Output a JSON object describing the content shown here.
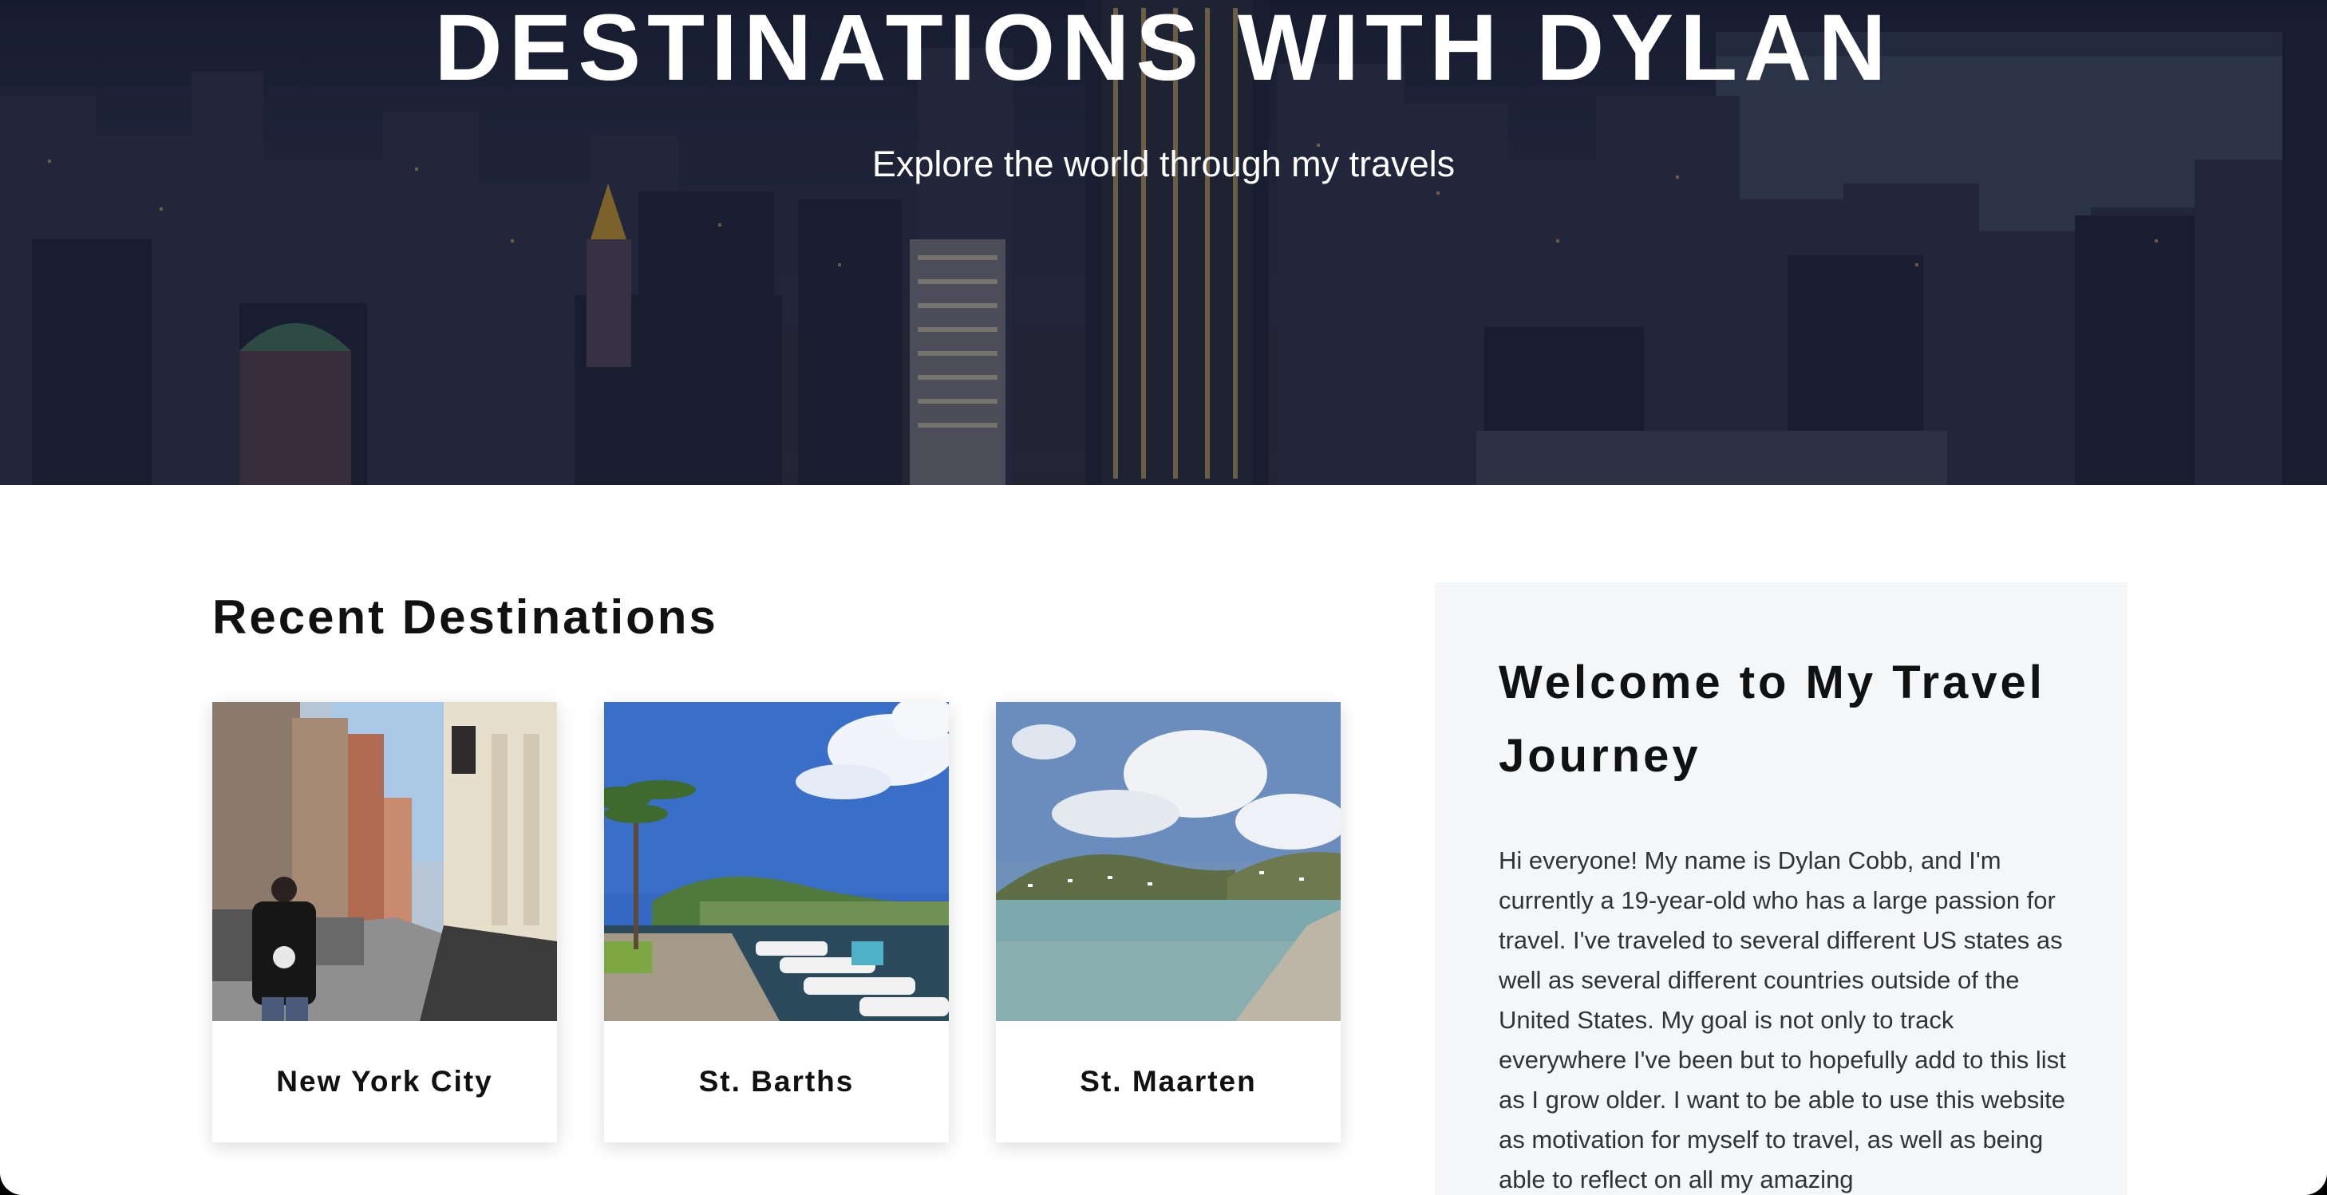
{
  "hero": {
    "title": "DESTINATIONS WITH DYLAN",
    "subtitle": "Explore the world through my travels"
  },
  "recent": {
    "heading": "Recent Destinations",
    "cards": [
      {
        "name": "New York City",
        "photo_icon": "city-street-photo"
      },
      {
        "name": "St. Barths",
        "photo_icon": "harbor-photo"
      },
      {
        "name": "St. Maarten",
        "photo_icon": "beach-photo"
      }
    ]
  },
  "welcome": {
    "heading": "Welcome to My Travel Journey",
    "body": "Hi everyone! My name is Dylan Cobb, and I'm currently a 19-year-old who has a large passion for travel. I've traveled to several different US states as well as several different countries outside of the United States. My goal is not only to track everywhere I've been but to hopefully add to this list as I grow older. I want to be able to use this website as motivation for myself to travel, as well as being able to reflect on all my amazing"
  },
  "colors": {
    "hero_overlay": "#1e2236",
    "text_dark": "#111111",
    "panel_bg": "#f5f6f8"
  }
}
